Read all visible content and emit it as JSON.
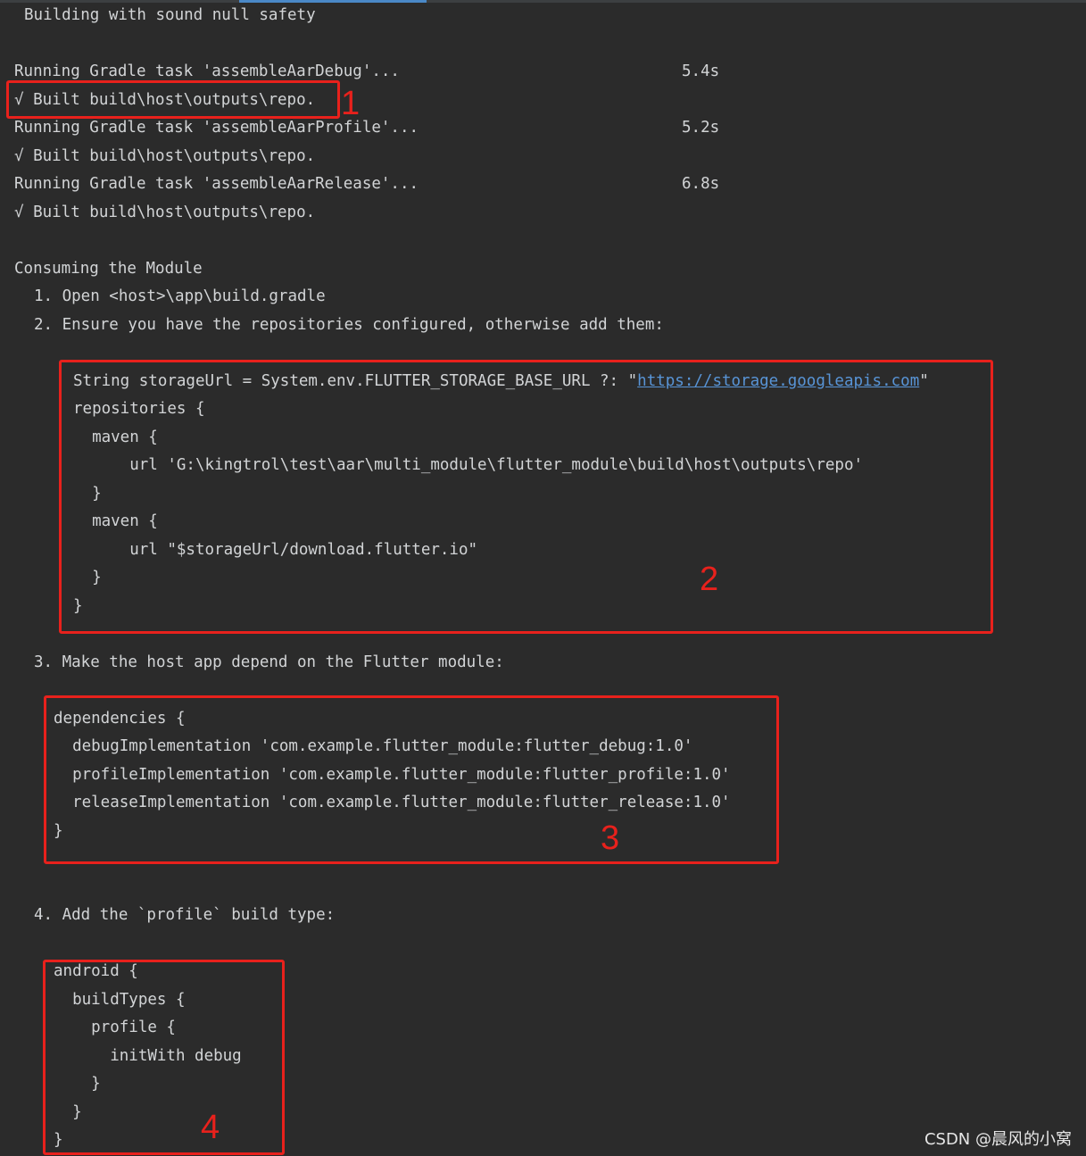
{
  "console": {
    "header": "Building with sound null safety",
    "tasks": [
      {
        "label": "Running Gradle task 'assembleAarDebug'...",
        "duration": "5.4s",
        "result": "√ Built build\\host\\outputs\\repo."
      },
      {
        "label": "Running Gradle task 'assembleAarProfile'...",
        "duration": "5.2s",
        "result": "√ Built build\\host\\outputs\\repo."
      },
      {
        "label": "Running Gradle task 'assembleAarRelease'...",
        "duration": "6.8s",
        "result": "√ Built build\\host\\outputs\\repo."
      }
    ],
    "consuming_title": "Consuming the Module",
    "steps": [
      "1. Open <host>\\app\\build.gradle",
      "2. Ensure you have the repositories configured, otherwise add them:",
      "3. Make the host app depend on the Flutter module:",
      "4. Add the `profile` build type:"
    ],
    "repositories_code": {
      "line1_prefix": "String storageUrl = System.env.FLUTTER_STORAGE_BASE_URL ?: \"",
      "line1_link": "https://storage.googleapis.com",
      "line1_suffix": "\"",
      "lines": [
        "repositories {",
        "  maven {",
        "      url 'G:\\kingtrol\\test\\aar\\multi_module\\flutter_module\\build\\host\\outputs\\repo'",
        "  }",
        "  maven {",
        "      url \"$storageUrl/download.flutter.io\"",
        "  }",
        "}"
      ]
    },
    "dependencies_code": [
      "dependencies {",
      "  debugImplementation 'com.example.flutter_module:flutter_debug:1.0'",
      "  profileImplementation 'com.example.flutter_module:flutter_profile:1.0'",
      "  releaseImplementation 'com.example.flutter_module:flutter_release:1.0'",
      "}"
    ],
    "android_code": [
      "android {",
      "  buildTypes {",
      "    profile {",
      "      initWith debug",
      "    }",
      "  }",
      "}"
    ]
  },
  "annotations": {
    "marker_1": "1",
    "marker_2": "2",
    "marker_3": "3",
    "marker_4": "4",
    "box_color": "#e8211c"
  },
  "watermark": "CSDN @晨风的小窝"
}
